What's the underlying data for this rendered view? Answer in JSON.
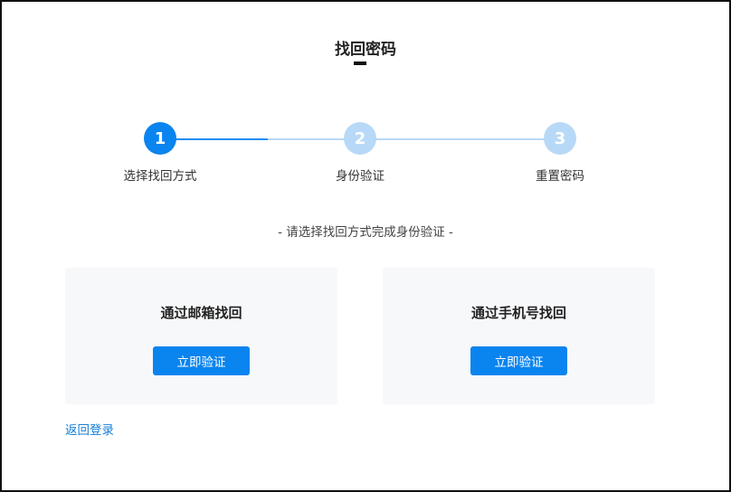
{
  "page": {
    "title": "找回密码",
    "subtitle": "- 请选择找回方式完成身份验证 -"
  },
  "steps": [
    {
      "number": "1",
      "label": "选择找回方式",
      "active": true
    },
    {
      "number": "2",
      "label": "身份验证",
      "active": false
    },
    {
      "number": "3",
      "label": "重置密码",
      "active": false
    }
  ],
  "progress": {
    "current_step": 1,
    "total_steps": 3
  },
  "options": [
    {
      "title": "通过邮箱找回",
      "button_label": "立即验证"
    },
    {
      "title": "通过手机号找回",
      "button_label": "立即验证"
    }
  ],
  "footer": {
    "back_link_label": "返回登录"
  },
  "colors": {
    "primary": "#0a84ef",
    "step_inactive": "#b7d9f7",
    "card_bg": "#f7f8fa",
    "link": "#1a7fd6"
  }
}
